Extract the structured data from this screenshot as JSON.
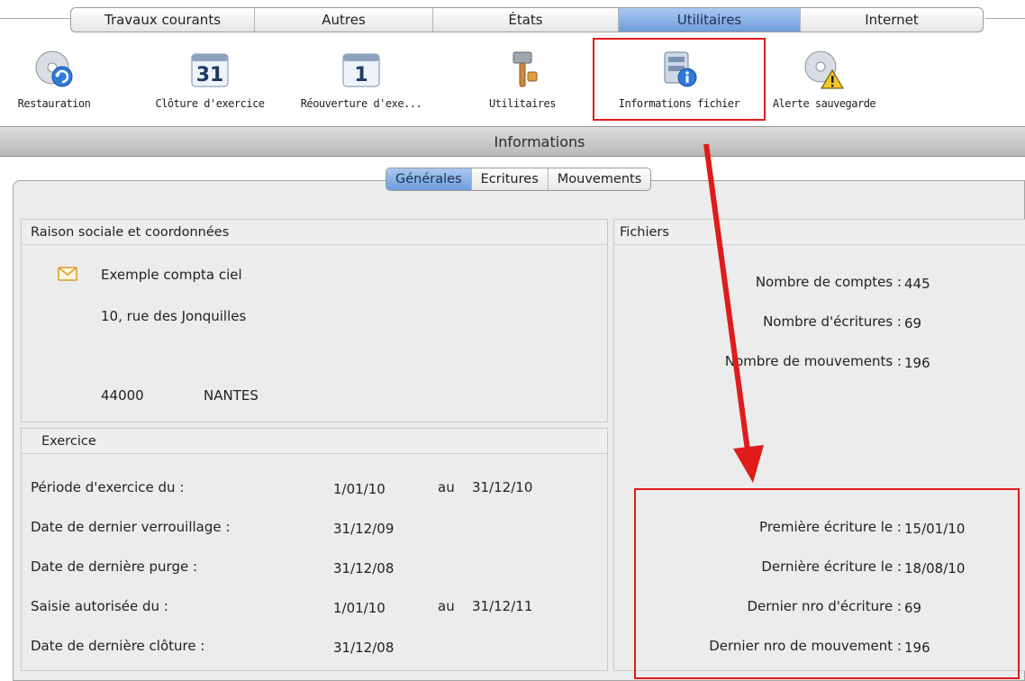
{
  "menu": {
    "tabs": [
      "Travaux courants",
      "Autres",
      "États",
      "Utilitaires",
      "Internet"
    ],
    "active": "Utilitaires"
  },
  "toolbar": {
    "items": [
      {
        "label": "Restauration",
        "icon": "restore-disk-icon"
      },
      {
        "label": "Clôture d'exercice",
        "icon": "calendar-31-icon",
        "day": "31"
      },
      {
        "label": "Réouverture d'exe...",
        "icon": "calendar-1-icon",
        "day": "1"
      },
      {
        "label": "Utilitaires",
        "icon": "hammer-tools-icon"
      },
      {
        "label": "Informations fichier",
        "icon": "file-info-icon"
      },
      {
        "label": "Alerte sauvegarde",
        "icon": "backup-alert-icon"
      }
    ]
  },
  "section": {
    "title": "Informations"
  },
  "subtabs": {
    "items": [
      "Générales",
      "Ecritures",
      "Mouvements"
    ],
    "active": "Générales"
  },
  "company": {
    "header": "Raison sociale et coordonnées",
    "name": "Exemple compta ciel",
    "address": "10, rue des Jonquilles",
    "postcode": "44000",
    "city": "NANTES"
  },
  "exercice": {
    "header": "Exercice",
    "rows": [
      {
        "label": "Période d'exercice du :",
        "v1": "1/01/10",
        "sep": "au",
        "v2": "31/12/10"
      },
      {
        "label": "Date de dernier verrouillage :",
        "v1": "31/12/09"
      },
      {
        "label": "Date de dernière purge :",
        "v1": "31/12/08"
      },
      {
        "label": "Saisie autorisée du :",
        "v1": "1/01/10",
        "sep": "au",
        "v2": "31/12/11"
      },
      {
        "label": "Date de dernière clôture :",
        "v1": "31/12/08"
      }
    ]
  },
  "fichiers": {
    "header": "Fichiers",
    "counts": [
      {
        "label": "Nombre de comptes :",
        "value": "445"
      },
      {
        "label": "Nombre d'écritures :",
        "value": "69"
      },
      {
        "label": "Nombre de mouvements :",
        "value": "196"
      }
    ],
    "details": [
      {
        "label": "Première écriture le :",
        "value": "15/01/10"
      },
      {
        "label": "Dernière écriture le :",
        "value": "18/08/10"
      },
      {
        "label": "Dernier nro d'écriture  :",
        "value": "69"
      },
      {
        "label": "Dernier nro de mouvement :",
        "value": "196"
      }
    ]
  },
  "colors": {
    "highlight": "#e01b1b",
    "activeTab": "#6e9edb"
  }
}
